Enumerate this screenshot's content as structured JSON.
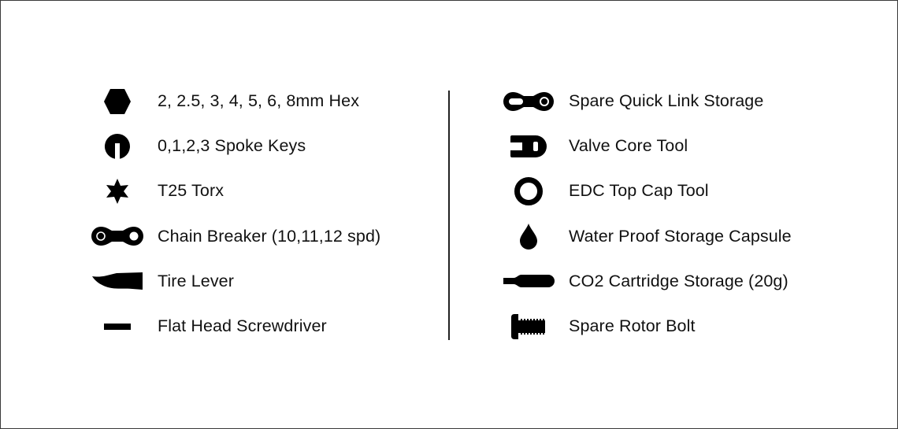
{
  "left_column": [
    {
      "icon": "hex-key-icon",
      "label": "2, 2.5, 3, 4, 5, 6, 8mm Hex"
    },
    {
      "icon": "spoke-key-icon",
      "label": "0,1,2,3 Spoke Keys"
    },
    {
      "icon": "torx-icon",
      "label": "T25 Torx"
    },
    {
      "icon": "chain-link-icon",
      "label": "Chain Breaker (10,11,12 spd)"
    },
    {
      "icon": "tire-lever-icon",
      "label": "Tire Lever"
    },
    {
      "icon": "flat-head-screwdriver-icon",
      "label": "Flat Head Screwdriver"
    }
  ],
  "right_column": [
    {
      "icon": "quick-link-icon",
      "label": "Spare Quick Link Storage"
    },
    {
      "icon": "valve-core-icon",
      "label": "Valve Core Tool"
    },
    {
      "icon": "ring-icon",
      "label": "EDC Top Cap Tool"
    },
    {
      "icon": "water-drop-icon",
      "label": "Water Proof Storage Capsule"
    },
    {
      "icon": "co2-cartridge-icon",
      "label": "CO2 Cartridge Storage (20g)"
    },
    {
      "icon": "rotor-bolt-icon",
      "label": "Spare Rotor Bolt"
    }
  ],
  "colors": {
    "icon": "#000000",
    "text": "#111111",
    "background": "#ffffff",
    "border": "#3a3a3a"
  }
}
